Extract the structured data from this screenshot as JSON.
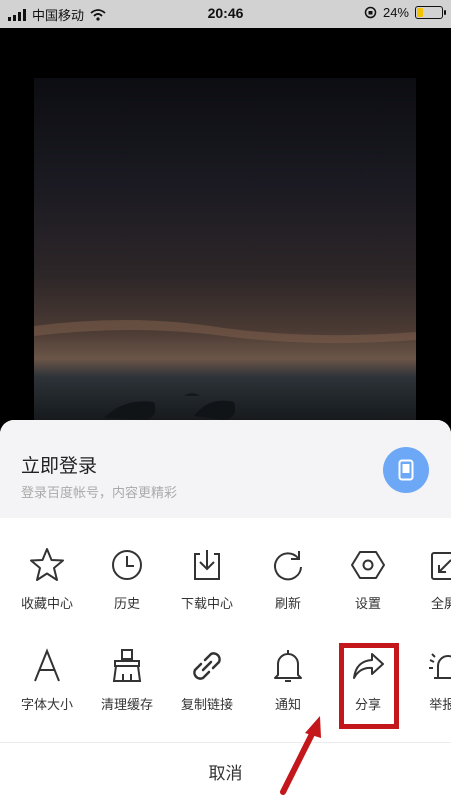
{
  "status_bar": {
    "carrier": "中国移动",
    "time": "20:46",
    "battery": "24%",
    "battery_level": 0.24
  },
  "login": {
    "title": "立即登录",
    "subtitle": "登录百度帐号，内容更精彩"
  },
  "menu_row1": [
    {
      "label": "收藏中心",
      "icon": "star-icon"
    },
    {
      "label": "历史",
      "icon": "clock-icon"
    },
    {
      "label": "下载中心",
      "icon": "download-icon"
    },
    {
      "label": "刷新",
      "icon": "refresh-icon"
    },
    {
      "label": "设置",
      "icon": "settings-hexagon-icon"
    },
    {
      "label": "全屏",
      "icon": "fullscreen-icon"
    }
  ],
  "menu_row2": [
    {
      "label": "字体大小",
      "icon": "font-size-icon"
    },
    {
      "label": "清理缓存",
      "icon": "brush-icon"
    },
    {
      "label": "复制链接",
      "icon": "link-icon"
    },
    {
      "label": "通知",
      "icon": "bell-icon"
    },
    {
      "label": "分享",
      "icon": "share-icon"
    },
    {
      "label": "举报/",
      "icon": "report-icon"
    }
  ],
  "cancel_label": "取消",
  "colors": {
    "highlight": "#c3171b",
    "avatar_bg": "#6da8f7"
  }
}
